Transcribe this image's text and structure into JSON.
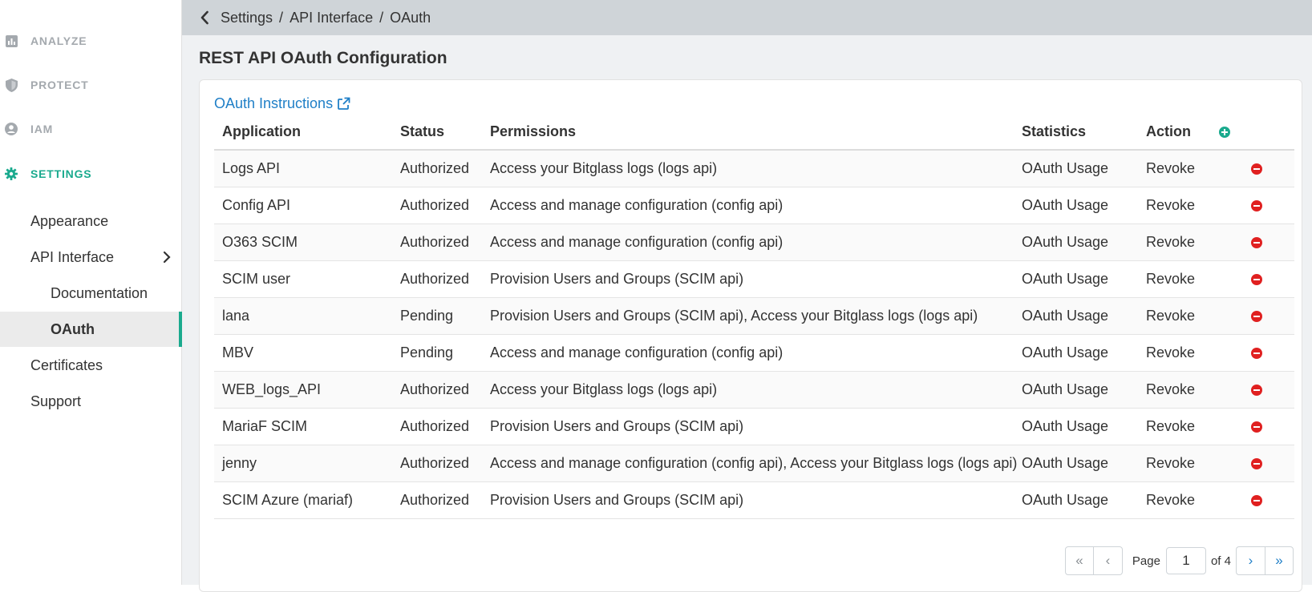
{
  "sidebar": {
    "sections": [
      {
        "label": "ANALYZE",
        "icon": "chart-icon"
      },
      {
        "label": "PROTECT",
        "icon": "shield-icon"
      },
      {
        "label": "IAM",
        "icon": "user-circle-icon"
      },
      {
        "label": "SETTINGS",
        "icon": "gear-icon"
      }
    ],
    "items": [
      {
        "label": "Appearance"
      },
      {
        "label": "API Interface"
      },
      {
        "label": "Documentation"
      },
      {
        "label": "OAuth"
      },
      {
        "label": "Certificates"
      },
      {
        "label": "Support"
      }
    ]
  },
  "breadcrumb": {
    "items": [
      "Settings",
      "API Interface",
      "OAuth"
    ],
    "separator": "/"
  },
  "page": {
    "title": "REST API OAuth Configuration",
    "instructions_link": "OAuth Instructions"
  },
  "table": {
    "headers": [
      "Application",
      "Status",
      "Permissions",
      "Statistics",
      "Action"
    ],
    "rows": [
      {
        "app": "Logs API",
        "status": "Authorized",
        "permissions": "Access your Bitglass logs (logs api)",
        "stats": "OAuth Usage",
        "action": "Revoke"
      },
      {
        "app": "Config API",
        "status": "Authorized",
        "permissions": "Access and manage configuration (config api)",
        "stats": "OAuth Usage",
        "action": "Revoke"
      },
      {
        "app": "O363 SCIM",
        "status": "Authorized",
        "permissions": "Access and manage configuration (config api)",
        "stats": "OAuth Usage",
        "action": "Revoke"
      },
      {
        "app": "SCIM user",
        "status": "Authorized",
        "permissions": "Provision Users and Groups (SCIM api)",
        "stats": "OAuth Usage",
        "action": "Revoke"
      },
      {
        "app": "lana",
        "status": "Pending",
        "permissions": "Provision Users and Groups (SCIM api), Access your Bitglass logs (logs api)",
        "stats": "OAuth Usage",
        "action": "Revoke"
      },
      {
        "app": "MBV",
        "status": "Pending",
        "permissions": "Access and manage configuration (config api)",
        "stats": "OAuth Usage",
        "action": "Revoke"
      },
      {
        "app": "WEB_logs_API",
        "status": "Authorized",
        "permissions": "Access your Bitglass logs (logs api)",
        "stats": "OAuth Usage",
        "action": "Revoke"
      },
      {
        "app": "MariaF SCIM",
        "status": "Authorized",
        "permissions": "Provision Users and Groups (SCIM api)",
        "stats": "OAuth Usage",
        "action": "Revoke"
      },
      {
        "app": "jenny",
        "status": "Authorized",
        "permissions": "Access and manage configuration (config api), Access your Bitglass logs (logs api)",
        "stats": "OAuth Usage",
        "action": "Revoke"
      },
      {
        "app": "SCIM Azure (mariaf)",
        "status": "Authorized",
        "permissions": "Provision Users and Groups (SCIM api)",
        "stats": "OAuth Usage",
        "action": "Revoke"
      }
    ]
  },
  "pagination": {
    "first": "«",
    "prev": "‹",
    "page_label": "Page",
    "current": "1",
    "of_label": "of 4",
    "next": "›",
    "last": "»"
  },
  "colors": {
    "accent": "#1aaa8e",
    "link": "#1f7fc7",
    "remove": "#e02020",
    "add": "#1aaa8e"
  }
}
